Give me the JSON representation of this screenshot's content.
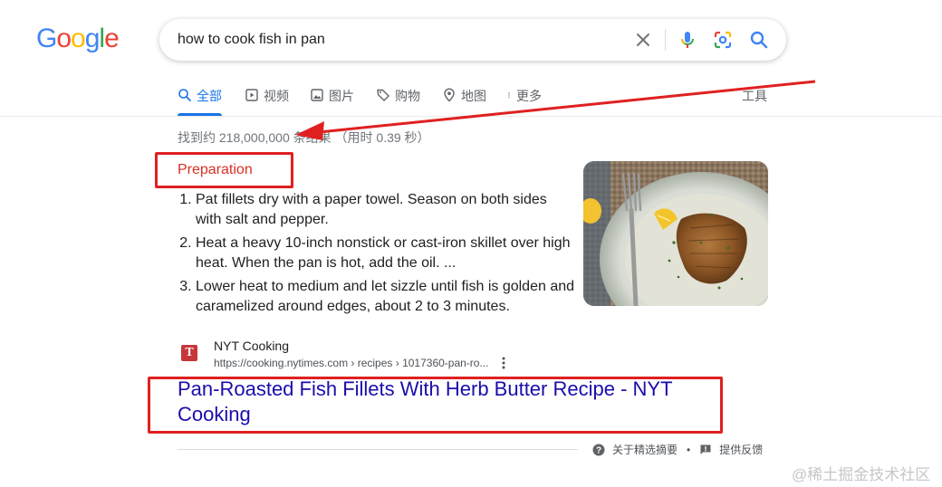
{
  "logo": {
    "letters": [
      {
        "char": "G",
        "color": "#4285F4"
      },
      {
        "char": "o",
        "color": "#EA4335"
      },
      {
        "char": "o",
        "color": "#FBBC05"
      },
      {
        "char": "g",
        "color": "#4285F4"
      },
      {
        "char": "l",
        "color": "#34A853"
      },
      {
        "char": "e",
        "color": "#EA4335"
      }
    ]
  },
  "search": {
    "value": "how to cook fish in pan",
    "icons": [
      "clear-icon",
      "mic-icon",
      "lens-icon",
      "search-icon"
    ]
  },
  "tabs": [
    {
      "label": "全部",
      "icon": "search-icon",
      "active": true
    },
    {
      "label": "视频",
      "icon": "video-icon",
      "active": false
    },
    {
      "label": "图片",
      "icon": "image-icon",
      "active": false
    },
    {
      "label": "购物",
      "icon": "tag-icon",
      "active": false
    },
    {
      "label": "地图",
      "icon": "map-pin-icon",
      "active": false
    },
    {
      "label": "更多",
      "icon": "more-vert-icon",
      "active": false
    }
  ],
  "tools_label": "工具",
  "stats": "找到约 218,000,000 条结果 （用时 0.39 秒）",
  "snippet": {
    "heading": "Preparation",
    "steps": [
      "Pat fillets dry with a paper towel. Season on both sides with salt and pepper.",
      "Heat a heavy 10-inch nonstick or cast-iron skillet over high heat. When the pan is hot, add the oil. ...",
      "Lower heat to medium and let sizzle until fish is golden and caramelized around edges, about 2 to 3 minutes."
    ],
    "image_desc": "fish-fillet-plate-image"
  },
  "source": {
    "favicon_letter": "T",
    "site_name": "NYT Cooking",
    "url": "https://cooking.nytimes.com › recipes › 1017360-pan-ro..."
  },
  "result_title": "Pan-Roasted Fish Fillets With Herb Butter Recipe - NYT Cooking",
  "footer": {
    "about_label": "关于精选摘要",
    "feedback_label": "提供反馈"
  },
  "watermark": "@稀土掘金技术社区",
  "colors": {
    "accent": "#1a73e8",
    "link": "#1a0dab",
    "annotation": "#e02020"
  }
}
